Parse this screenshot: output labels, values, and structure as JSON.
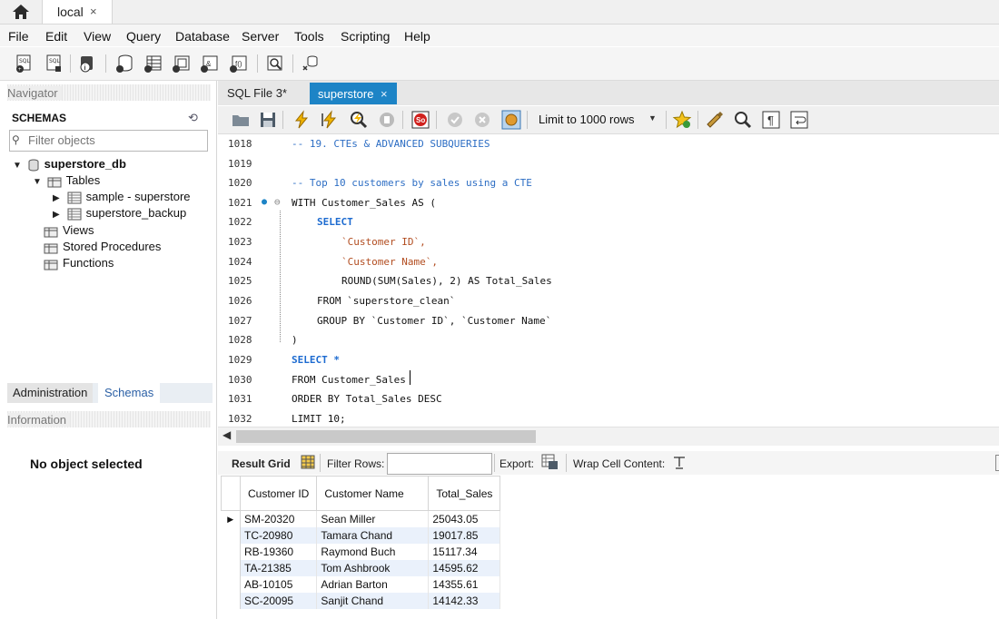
{
  "connection_tab": {
    "label": "local",
    "close": "×"
  },
  "menu": [
    "File",
    "Edit",
    "View",
    "Query",
    "Database",
    "Server",
    "Tools",
    "Scripting",
    "Help"
  ],
  "navigator": {
    "title": "Navigator",
    "schemas_label": "SCHEMAS",
    "filter_placeholder": "Filter objects",
    "schema_name": "superstore_db",
    "tables_label": "Tables",
    "tables": [
      "sample - superstore",
      "superstore_backup"
    ],
    "views_label": "Views",
    "procedures_label": "Stored Procedures",
    "functions_label": "Functions"
  },
  "bottom_tabs": {
    "administration": "Administration",
    "schemas": "Schemas"
  },
  "information": {
    "title": "Information",
    "message": "No object selected"
  },
  "editor_tabs": {
    "sql_file": "SQL File 3*",
    "active": "superstore",
    "close": "×"
  },
  "editor_toolbar": {
    "limit": "Limit to 1000 rows"
  },
  "code_lines": [
    {
      "num": "1018",
      "text": "-- 19. CTEs & ADVANCED SUBQUERIES"
    },
    {
      "num": "1019",
      "text": ""
    },
    {
      "num": "1020",
      "text": "-- Top 10 customers by sales using a CTE"
    },
    {
      "num": "1021",
      "text": "WITH Customer_Sales AS ("
    },
    {
      "num": "1022",
      "text": "SELECT"
    },
    {
      "num": "1023",
      "text": "`Customer ID`,"
    },
    {
      "num": "1024",
      "text": "`Customer Name`,"
    },
    {
      "num": "1025",
      "text": "ROUND(SUM(Sales), 2) AS Total_Sales"
    },
    {
      "num": "1026",
      "text": "FROM `superstore_clean`"
    },
    {
      "num": "1027",
      "text": "GROUP BY `Customer ID`, `Customer Name`"
    },
    {
      "num": "1028",
      "text": ")"
    },
    {
      "num": "1029",
      "text": "SELECT *"
    },
    {
      "num": "1030",
      "text": "FROM Customer_Sales"
    },
    {
      "num": "1031",
      "text": "ORDER BY Total_Sales DESC"
    },
    {
      "num": "1032",
      "text": "LIMIT 10;"
    }
  ],
  "result_toolbar": {
    "result_grid": "Result Grid",
    "filter_rows": "Filter Rows:",
    "export": "Export:",
    "wrap": "Wrap Cell Content:"
  },
  "result_grid": {
    "columns": [
      "Customer ID",
      "Customer Name",
      "Total_Sales"
    ],
    "rows": [
      [
        "SM-20320",
        "Sean Miller",
        "25043.05"
      ],
      [
        "TC-20980",
        "Tamara Chand",
        "19017.85"
      ],
      [
        "RB-19360",
        "Raymond Buch",
        "15117.34"
      ],
      [
        "TA-21385",
        "Tom Ashbrook",
        "14595.62"
      ],
      [
        "AB-10105",
        "Adrian Barton",
        "14355.61"
      ],
      [
        "SC-20095",
        "Sanjit Chand",
        "14142.33"
      ]
    ]
  },
  "colors": {
    "active_tab": "#1d84c6",
    "keyword": "#1d6bd0",
    "string": "#b24d20",
    "row_alt": "#eaf1fb"
  }
}
